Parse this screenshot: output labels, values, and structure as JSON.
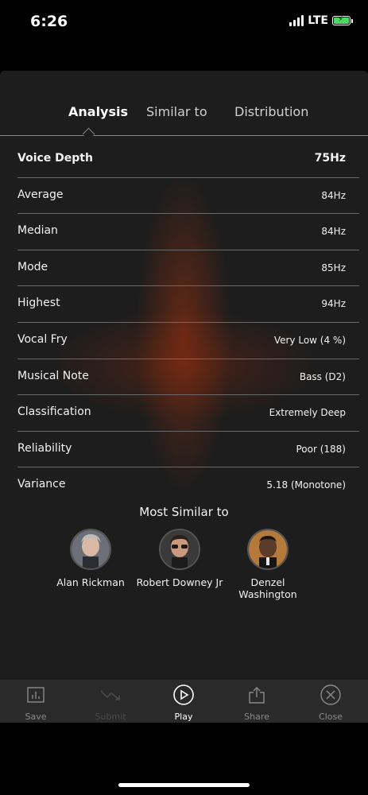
{
  "status_bar": {
    "time": "6:26",
    "network": "LTE",
    "battery_color": "#4cd964"
  },
  "tabs": [
    {
      "label": "Analysis",
      "active": true
    },
    {
      "label": "Similar to",
      "active": false
    },
    {
      "label": "Distribution",
      "active": false
    }
  ],
  "metrics": [
    {
      "label": "Voice Depth",
      "value": "75Hz"
    },
    {
      "label": "Average",
      "value": "84Hz"
    },
    {
      "label": "Median",
      "value": "84Hz"
    },
    {
      "label": "Mode",
      "value": "85Hz"
    },
    {
      "label": "Highest",
      "value": "94Hz"
    },
    {
      "label": "Vocal Fry",
      "value": "Very Low (4 %)"
    },
    {
      "label": "Musical Note",
      "value": "Bass (D2)"
    },
    {
      "label": "Classification",
      "value": "Extremely Deep"
    },
    {
      "label": "Reliability",
      "value": "Poor (188)"
    },
    {
      "label": "Variance",
      "value": "5.18 (Monotone)"
    }
  ],
  "similar": {
    "title": "Most Similar to",
    "people": [
      {
        "name": "Alan Rickman",
        "avatar": "avatar-alan-rickman"
      },
      {
        "name": "Robert Downey Jr",
        "avatar": "avatar-robert-downey-jr"
      },
      {
        "name": "Denzel Washington",
        "avatar": "avatar-denzel-washington"
      }
    ]
  },
  "toolbar": {
    "items": [
      {
        "label": "Save",
        "icon": "chart-icon",
        "enabled": true
      },
      {
        "label": "Submit",
        "icon": "trend-down-icon",
        "enabled": false
      },
      {
        "label": "Play",
        "icon": "play-circle-icon",
        "enabled": true
      },
      {
        "label": "Share",
        "icon": "share-icon",
        "enabled": true
      },
      {
        "label": "Close",
        "icon": "close-circle-icon",
        "enabled": true
      }
    ]
  },
  "colors": {
    "accent_glow": "#a0320f",
    "panel_bg": "#1d1d1d",
    "toolbar_bg": "#2a2a2a"
  }
}
